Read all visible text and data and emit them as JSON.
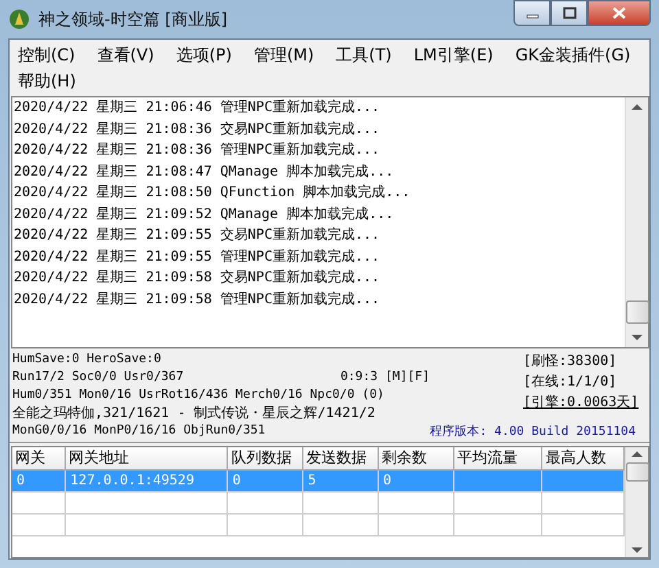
{
  "window": {
    "title": "神之领域-时空篇 [商业版]"
  },
  "menu": [
    "控制(C)",
    "查看(V)",
    "选项(P)",
    "管理(M)",
    "工具(T)",
    "LM引擎(E)",
    "GK金装插件(G)",
    "帮助(H)"
  ],
  "log": [
    "2020/4/22 星期三 21:06:46 管理NPC重新加载完成...",
    "2020/4/22 星期三 21:08:36 交易NPC重新加载完成...",
    "2020/4/22 星期三 21:08:36 管理NPC重新加载完成...",
    "2020/4/22 星期三 21:08:47 QManage 脚本加载完成...",
    "2020/4/22 星期三 21:08:50 QFunction 脚本加载完成...",
    "2020/4/22 星期三 21:09:52 QManage 脚本加载完成...",
    "2020/4/22 星期三 21:09:55 交易NPC重新加载完成...",
    "2020/4/22 星期三 21:09:55 管理NPC重新加载完成...",
    "2020/4/22 星期三 21:09:58 交易NPC重新加载完成...",
    "2020/4/22 星期三 21:09:58 管理NPC重新加载完成..."
  ],
  "status": {
    "line_1": "HumSave:0 HeroSave:0",
    "line_2": "Run17/2 Soc0/0 Usr0/367",
    "timer": "0:9:3 [M][F]",
    "line_3": "Hum0/351 Mon0/16 UsrRot16/436 Merch0/16 Npc0/0 (0)",
    "line_4": "全能之玛特伽,321/1621 - 制式传说・星辰之辉/1421/2",
    "line_5": "MonG0/0/16 MonP0/16/16 ObjRun0/351",
    "monsters": "[刷怪:38300]",
    "online": "[在线:1/1/0]",
    "engine": "[引擎:0.0063天]",
    "version": "程序版本: 4.00 Build 20151104"
  },
  "table": {
    "columns": [
      "网关",
      "网关地址",
      "队列数据",
      "发送数据",
      "剩余数",
      "平均流量",
      "最高人数"
    ],
    "rows": [
      {
        "cells": [
          "0",
          "127.0.0.1:49529",
          "0",
          "5",
          "0",
          "",
          ""
        ],
        "selected": true
      }
    ]
  }
}
